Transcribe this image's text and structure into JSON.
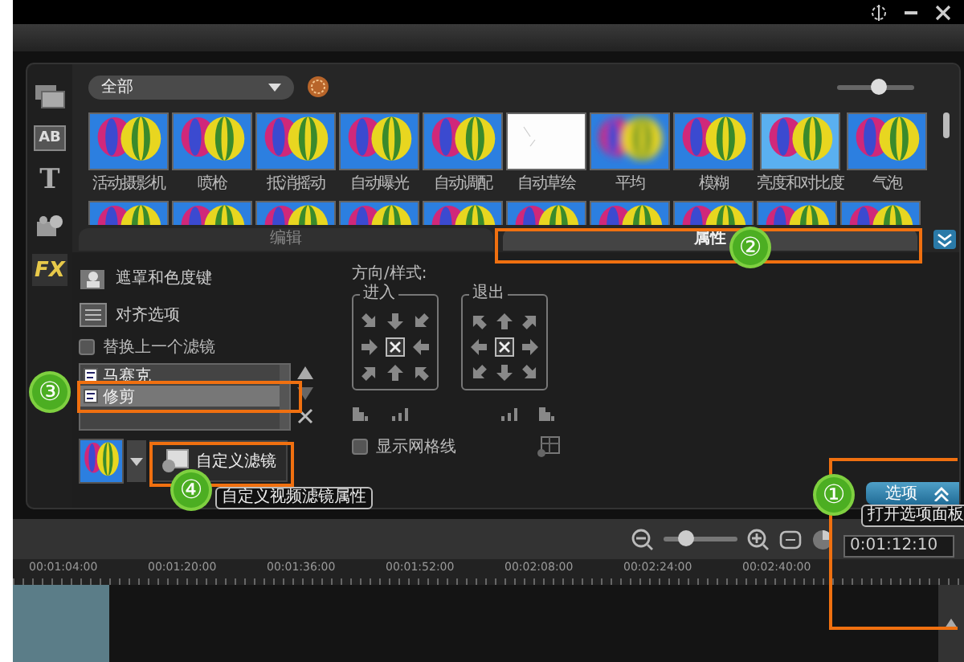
{
  "sidebar": [
    {
      "kind": "media",
      "selected": false
    },
    {
      "kind": "transition",
      "glyph": "AB",
      "selected": false
    },
    {
      "kind": "title",
      "glyph": "T",
      "selected": false
    },
    {
      "kind": "graphic",
      "selected": false
    },
    {
      "kind": "filter",
      "glyph": "FX",
      "selected": true
    }
  ],
  "library": {
    "category": "全部",
    "thumb_size": {
      "level": 0.55
    },
    "effects": [
      {
        "label": "活动摄影机",
        "kind": "balloon"
      },
      {
        "label": "喷枪",
        "kind": "balloon"
      },
      {
        "label": "抵消摇动",
        "kind": "balloon"
      },
      {
        "label": "自动曝光",
        "kind": "balloon"
      },
      {
        "label": "自动调配",
        "kind": "balloon"
      },
      {
        "label": "自动草绘",
        "kind": "sketch"
      },
      {
        "label": "平均",
        "kind": "blur"
      },
      {
        "label": "模糊",
        "kind": "balloon"
      },
      {
        "label": "亮度和对比度",
        "kind": "bright"
      },
      {
        "label": "气泡",
        "kind": "balloon"
      }
    ]
  },
  "tabs": [
    {
      "label": "编辑",
      "selected": false
    },
    {
      "label": "属性",
      "selected": true
    }
  ],
  "properties": {
    "mask_button": "遮罩和色度键",
    "align_button": "对齐选项",
    "replace_filter": {
      "label": "替换上一个滤镜",
      "checked": false
    },
    "filters": [
      {
        "label": "马赛克",
        "selected": false
      },
      {
        "label": "修剪",
        "selected": true
      }
    ],
    "custom_filter_button": "自定义滤镜",
    "direction_label": "方向/样式:",
    "enter_group": "进入",
    "exit_group": "退出",
    "show_grid": {
      "label": "显示网格线",
      "checked": false
    }
  },
  "options_button": "选项",
  "timeline": {
    "zoom": {
      "level": 0.3
    },
    "timecode": "0:01:12:10",
    "ruler": [
      "00:01:04:00",
      "00:01:20:00",
      "00:01:36:00",
      "00:01:52:00",
      "00:02:08:00",
      "00:02:24:00",
      "00:02:40:00"
    ]
  },
  "annotations": [
    {
      "number": "①",
      "tooltip": "打开选项面板"
    },
    {
      "number": "②"
    },
    {
      "number": "③"
    },
    {
      "number": "④",
      "tooltip": "自定义视频滤镜属性"
    }
  ]
}
